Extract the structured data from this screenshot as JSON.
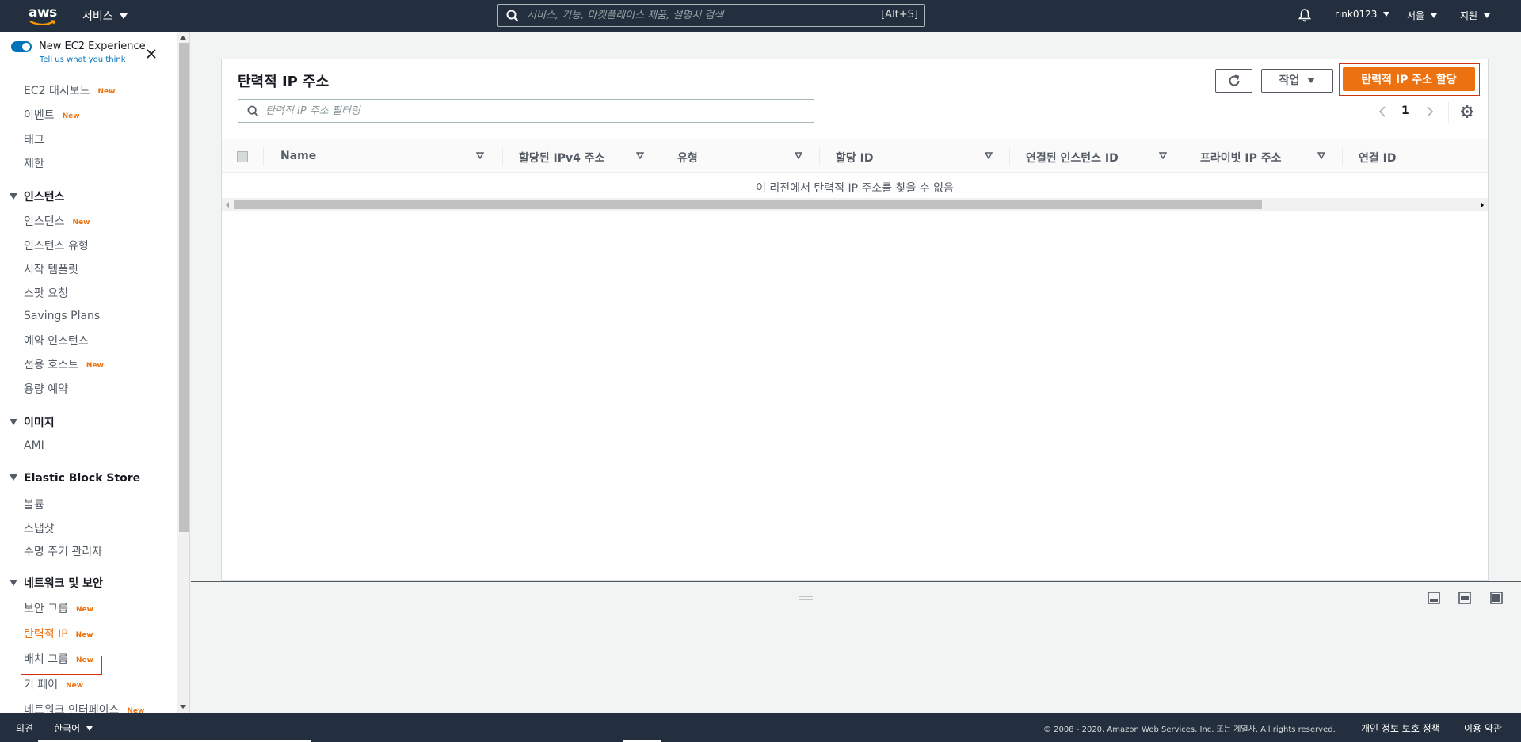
{
  "topnav": {
    "logo_text": "aws",
    "services_label": "서비스",
    "search_placeholder": "서비스, 기능, 마켓플레이스 제품, 설명서 검색",
    "search_shortcut": "[Alt+S]",
    "account_label": "rink0123",
    "region_label": "서울",
    "support_label": "지원"
  },
  "sidebar": {
    "experience_title": "New EC2 Experience",
    "experience_link": "Tell us what you think",
    "new_badge": "New",
    "items": [
      {
        "label": "EC2 대시보드",
        "new": true
      },
      {
        "label": "이벤트",
        "new": true
      },
      {
        "label": "태그",
        "new": false
      },
      {
        "label": "제한",
        "new": false
      }
    ],
    "sections": [
      {
        "label": "인스턴스",
        "items": [
          {
            "label": "인스턴스",
            "new": true
          },
          {
            "label": "인스턴스 유형",
            "new": false
          },
          {
            "label": "시작 템플릿",
            "new": false
          },
          {
            "label": "스팟 요청",
            "new": false
          },
          {
            "label": "Savings Plans",
            "new": false
          },
          {
            "label": "예약 인스턴스",
            "new": false
          },
          {
            "label": "전용 호스트",
            "new": true
          },
          {
            "label": "용량 예약",
            "new": false
          }
        ]
      },
      {
        "label": "이미지",
        "items": [
          {
            "label": "AMI",
            "new": false
          }
        ]
      },
      {
        "label": "Elastic Block Store",
        "items": [
          {
            "label": "볼륨",
            "new": false
          },
          {
            "label": "스냅샷",
            "new": false
          },
          {
            "label": "수명 주기 관리자",
            "new": false
          }
        ]
      },
      {
        "label": "네트워크 및 보안",
        "items": [
          {
            "label": "보안 그룹",
            "new": true
          },
          {
            "label": "탄력적 IP",
            "new": true,
            "active": true
          },
          {
            "label": "배치 그룹",
            "new": true
          },
          {
            "label": "키 페어",
            "new": true
          },
          {
            "label": "네트워크 인터페이스",
            "new": true
          }
        ]
      }
    ]
  },
  "panel": {
    "title": "탄력적 IP 주소",
    "actions_label": "작업",
    "allocate_label": "탄력적 IP 주소 할당",
    "filter_placeholder": "탄력적 IP 주소 필터링",
    "current_page": "1",
    "columns": [
      "Name",
      "할당된 IPv4 주소",
      "유형",
      "할당 ID",
      "연결된 인스턴스 ID",
      "프라이빗 IP 주소",
      "연결 ID"
    ],
    "empty_message": "이 리전에서 탄력적 IP 주소를 찾을 수 없음"
  },
  "footer": {
    "feedback": "의견",
    "language": "한국어",
    "copyright": "© 2008 - 2020, Amazon Web Services, Inc. 또는 계열사. All rights reserved.",
    "privacy": "개인 정보 보호 정책",
    "terms": "이용 약관"
  },
  "colors": {
    "nav_bg": "#232f3e",
    "accent": "#ec7211",
    "link": "#0073bb",
    "highlight": "#d13212"
  }
}
